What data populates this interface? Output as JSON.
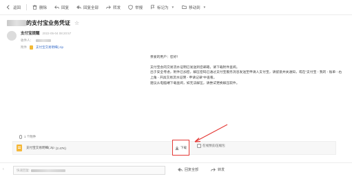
{
  "toolbar": {
    "back": "返回",
    "delete": "删除",
    "reply": "回复",
    "reply_all": "回复全部",
    "forward": "转发",
    "report": "举报",
    "mark_as": "标记为",
    "move_to": "移动到"
  },
  "mail": {
    "subject": "的支付宝业务凭证",
    "sender_name": "支付宝提醒",
    "sender_time": "2022-05-04 08:20:57",
    "recipient_label": "收件人：",
    "attachment_label": "附件",
    "attachment_link": "支付宝交易明细(.zip"
  },
  "body": {
    "greeting": "亲爱的用户：您好！",
    "p1": "支付宝会的交易流水证明已发送到您邮箱，请下载附件查阅。",
    "p2": "出于安全考虑，附件已加密，解压密码已通过支付宝服务消息发送至申请人支付宝，请留意并关通知，或在“支付宝 - 我的 - 账单 - 右上角 - 开具交易流水证明 - 申请记录”中查看。",
    "p3": "建议从电脑端下载查阅，如无法解压，请尝试更换解压软件。"
  },
  "attachments": {
    "header": "1 个附件",
    "file_name": "支付宝交易明细(.zip",
    "file_size": "(2.47K)",
    "download": "下载",
    "preview": "在线预览/压缩包"
  },
  "bottom": {
    "reply_placeholder": "快速回复: ",
    "reply_all": "回复全部",
    "forward": "转发"
  },
  "colors": {
    "accent_red": "#e53935",
    "link_blue": "#3b6fc9",
    "file_yellow": "#f5b83a"
  }
}
